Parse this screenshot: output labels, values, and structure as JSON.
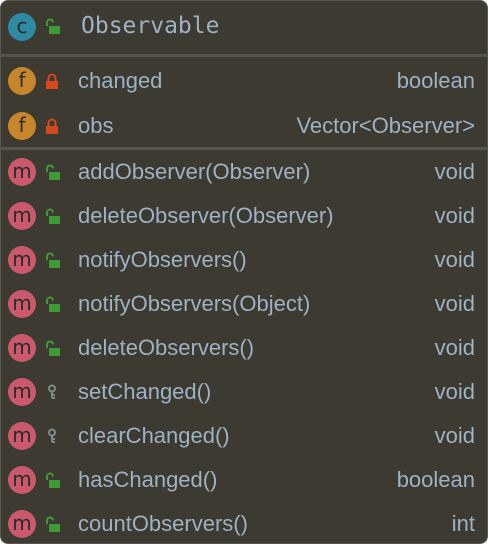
{
  "class": {
    "name": "Observable",
    "kind": "c",
    "visibility": "public"
  },
  "fields": [
    {
      "name": "changed",
      "type": "boolean",
      "visibility": "private"
    },
    {
      "name": "obs",
      "type": "Vector<Observer>",
      "visibility": "private"
    }
  ],
  "methods": [
    {
      "name": "addObserver(Observer)",
      "type": "void",
      "visibility": "public"
    },
    {
      "name": "deleteObserver(Observer)",
      "type": "void",
      "visibility": "public"
    },
    {
      "name": "notifyObservers()",
      "type": "void",
      "visibility": "public"
    },
    {
      "name": "notifyObservers(Object)",
      "type": "void",
      "visibility": "public"
    },
    {
      "name": "deleteObservers()",
      "type": "void",
      "visibility": "public"
    },
    {
      "name": "setChanged()",
      "type": "void",
      "visibility": "protected"
    },
    {
      "name": "clearChanged()",
      "type": "void",
      "visibility": "protected"
    },
    {
      "name": "hasChanged()",
      "type": "boolean",
      "visibility": "public"
    },
    {
      "name": "countObservers()",
      "type": "int",
      "visibility": "public"
    }
  ],
  "badges": {
    "class": "c",
    "field": "f",
    "method": "m"
  },
  "colors": {
    "class": "#2e8aa3",
    "field": "#c8862c",
    "method": "#c9596b",
    "public": "#3f9a36",
    "private": "#d4491e",
    "protected": "#7f8a8a"
  }
}
